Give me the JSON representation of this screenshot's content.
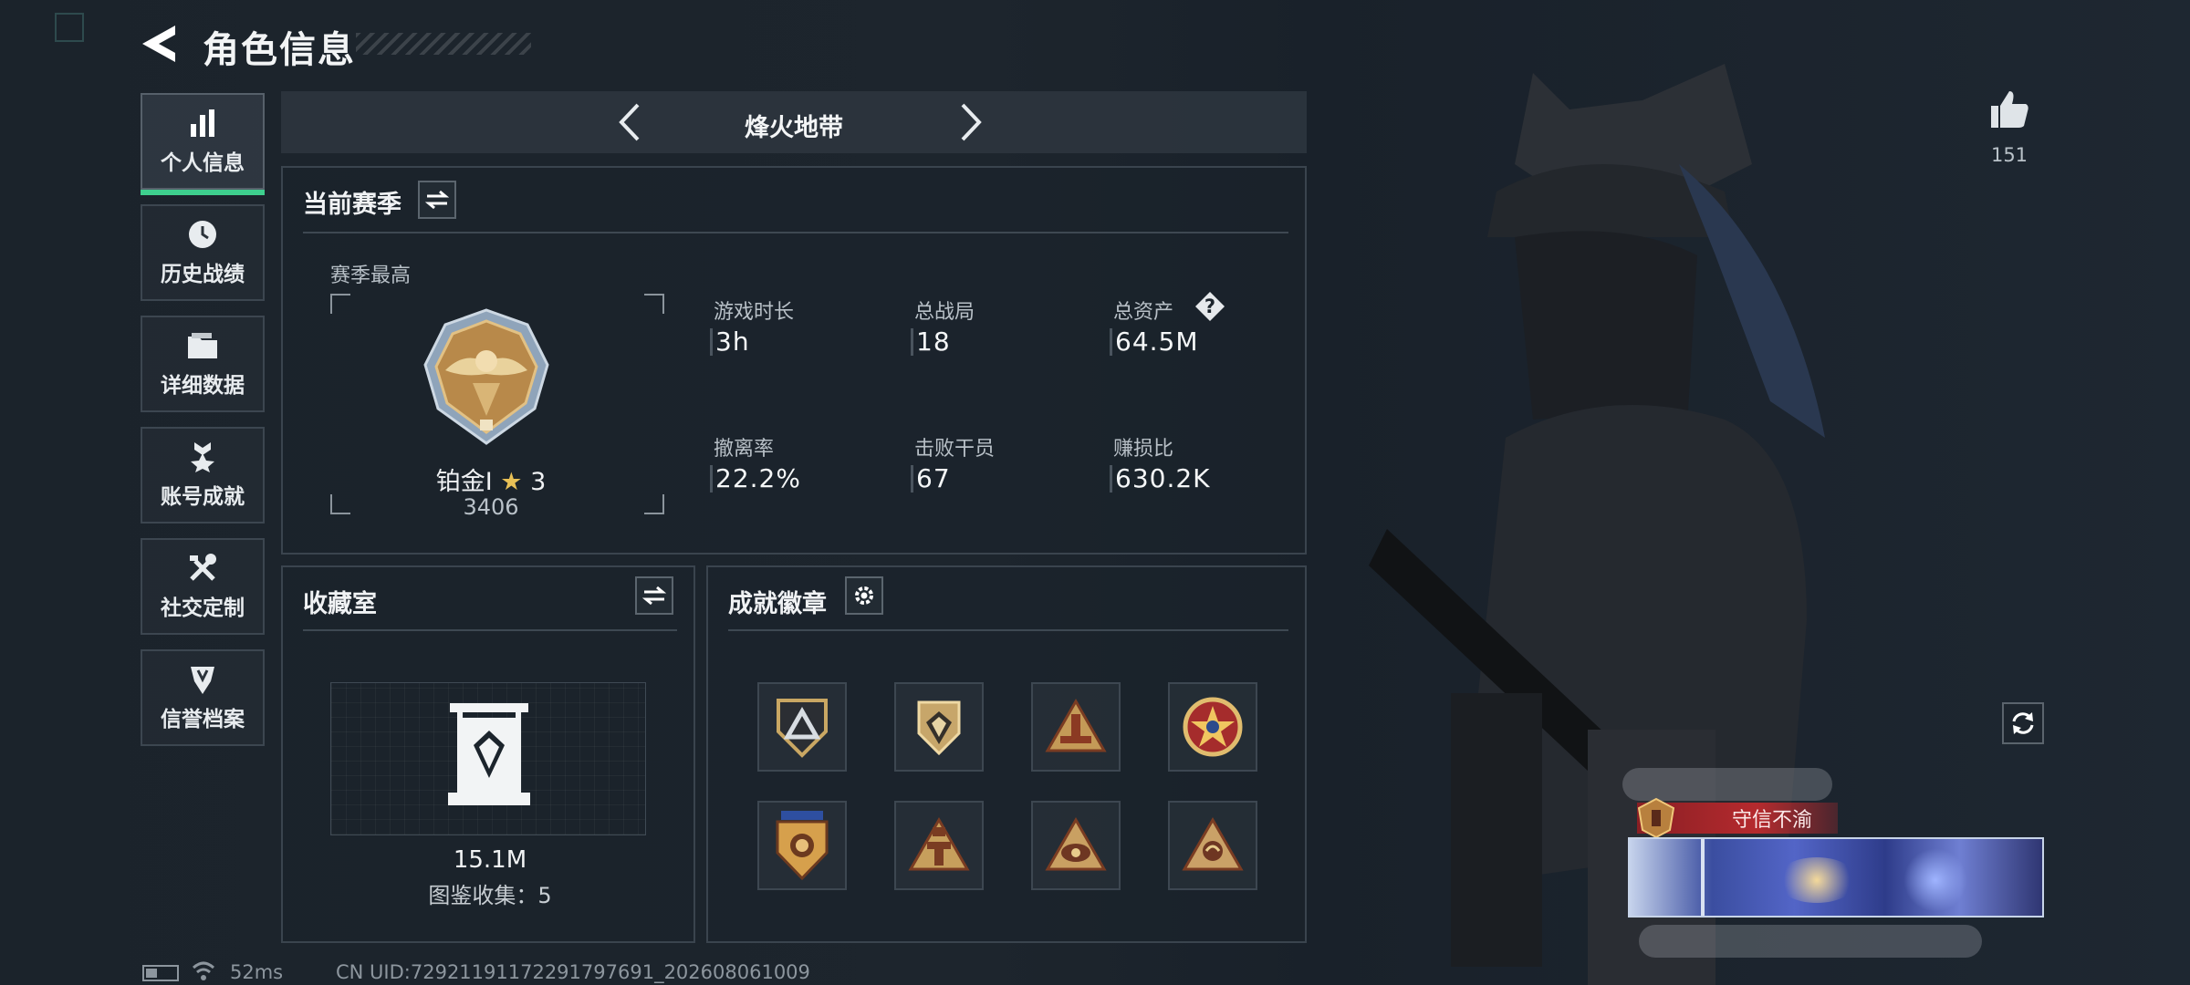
{
  "header": {
    "title": "角色信息",
    "back_icon": "back-arrow-icon"
  },
  "nav": [
    {
      "label": "个人信息",
      "icon": "bar-chart-icon",
      "active": true
    },
    {
      "label": "历史战绩",
      "icon": "clock-icon",
      "active": false
    },
    {
      "label": "详细数据",
      "icon": "folder-icon",
      "active": false
    },
    {
      "label": "账号成就",
      "icon": "medal-icon",
      "active": false
    },
    {
      "label": "社交定制",
      "icon": "tools-icon",
      "active": false
    },
    {
      "label": "信誉档案",
      "icon": "shield-icon",
      "active": false
    }
  ],
  "mode": {
    "title": "烽火地带"
  },
  "season": {
    "title": "当前赛季",
    "best_label": "赛季最高",
    "rank_name": "铂金Ⅰ",
    "rank_stars": "3",
    "rank_points": "3406",
    "stats": [
      {
        "label": "游戏时长",
        "value": "3h"
      },
      {
        "label": "总战局",
        "value": "18"
      },
      {
        "label": "总资产",
        "value": "64.5M",
        "help": "?"
      },
      {
        "label": "撤离率",
        "value": "22.2%"
      },
      {
        "label": "击败干员",
        "value": "67"
      },
      {
        "label": "赚损比",
        "value": "630.2K"
      }
    ]
  },
  "collection": {
    "title": "收藏室",
    "value": "15.1M",
    "count_label": "图鉴收集：5"
  },
  "achievements": {
    "title": "成就徽章",
    "badges": [
      "triangle-shield-badge",
      "gem-shield-badge",
      "triangle-gold-badge",
      "star-medal-badge",
      "wing-shield-badge",
      "tower-badge",
      "triangle-eye-badge",
      "triangle-hand-badge"
    ]
  },
  "profile": {
    "likes": "151",
    "title_tag": "守信不渝"
  },
  "status_bar": {
    "ping": "52ms",
    "uid": "CN UID:7292119117229179769​1_202608061009"
  },
  "colors": {
    "accent": "#3ecf8e",
    "tag_red": "#b52a2e",
    "panel_border": "#3a444e"
  }
}
